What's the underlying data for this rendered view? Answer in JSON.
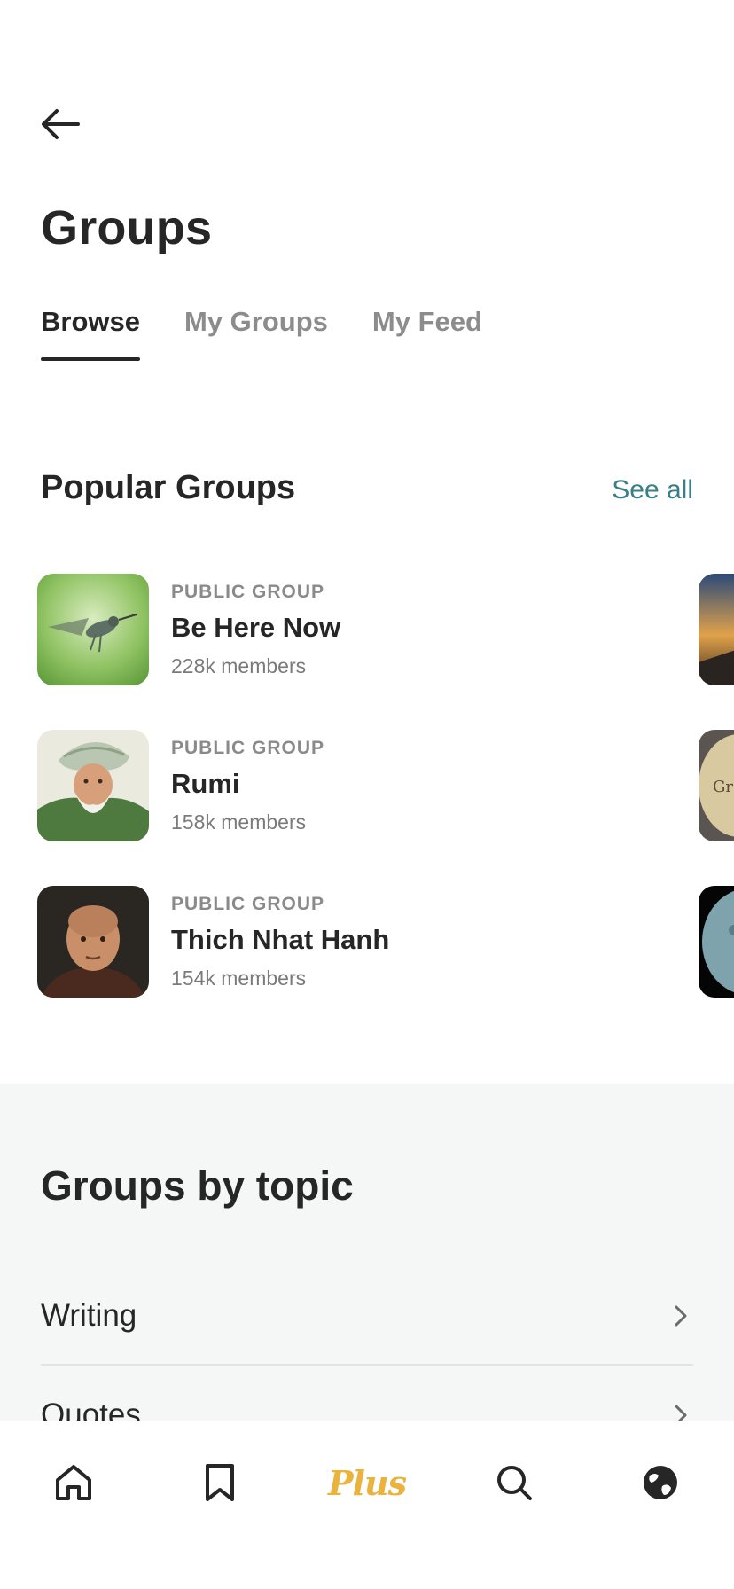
{
  "header": {
    "title": "Groups",
    "back_icon": "arrow-left-icon"
  },
  "tabs": [
    {
      "label": "Browse",
      "active": true
    },
    {
      "label": "My Groups",
      "active": false
    },
    {
      "label": "My Feed",
      "active": false
    }
  ],
  "popular": {
    "title": "Popular Groups",
    "see_all": "See all",
    "groups": [
      {
        "kicker": "PUBLIC GROUP",
        "name": "Be Here Now",
        "members": "228k members",
        "thumb": "hummingbird-photo"
      },
      {
        "kicker": "PUBLIC GROUP",
        "name": "Rumi",
        "members": "158k members",
        "thumb": "rumi-portrait"
      },
      {
        "kicker": "PUBLIC GROUP",
        "name": "Thich Nhat Hanh",
        "members": "154k members",
        "thumb": "monk-portrait"
      }
    ],
    "peek_text": "Gr"
  },
  "topics": {
    "title": "Groups by topic",
    "items": [
      {
        "label": "Writing"
      },
      {
        "label": "Quotes"
      }
    ]
  },
  "bottom_nav": {
    "items": [
      {
        "name": "home",
        "icon": "home-icon"
      },
      {
        "name": "bookmarks",
        "icon": "bookmark-icon"
      },
      {
        "name": "plus",
        "label": "Plus"
      },
      {
        "name": "search",
        "icon": "search-icon"
      },
      {
        "name": "community",
        "icon": "globe-icon"
      }
    ]
  },
  "colors": {
    "accent_link": "#3a7f86",
    "plus_gold": "#e9b33e",
    "topic_bg": "#f5f6f6"
  }
}
